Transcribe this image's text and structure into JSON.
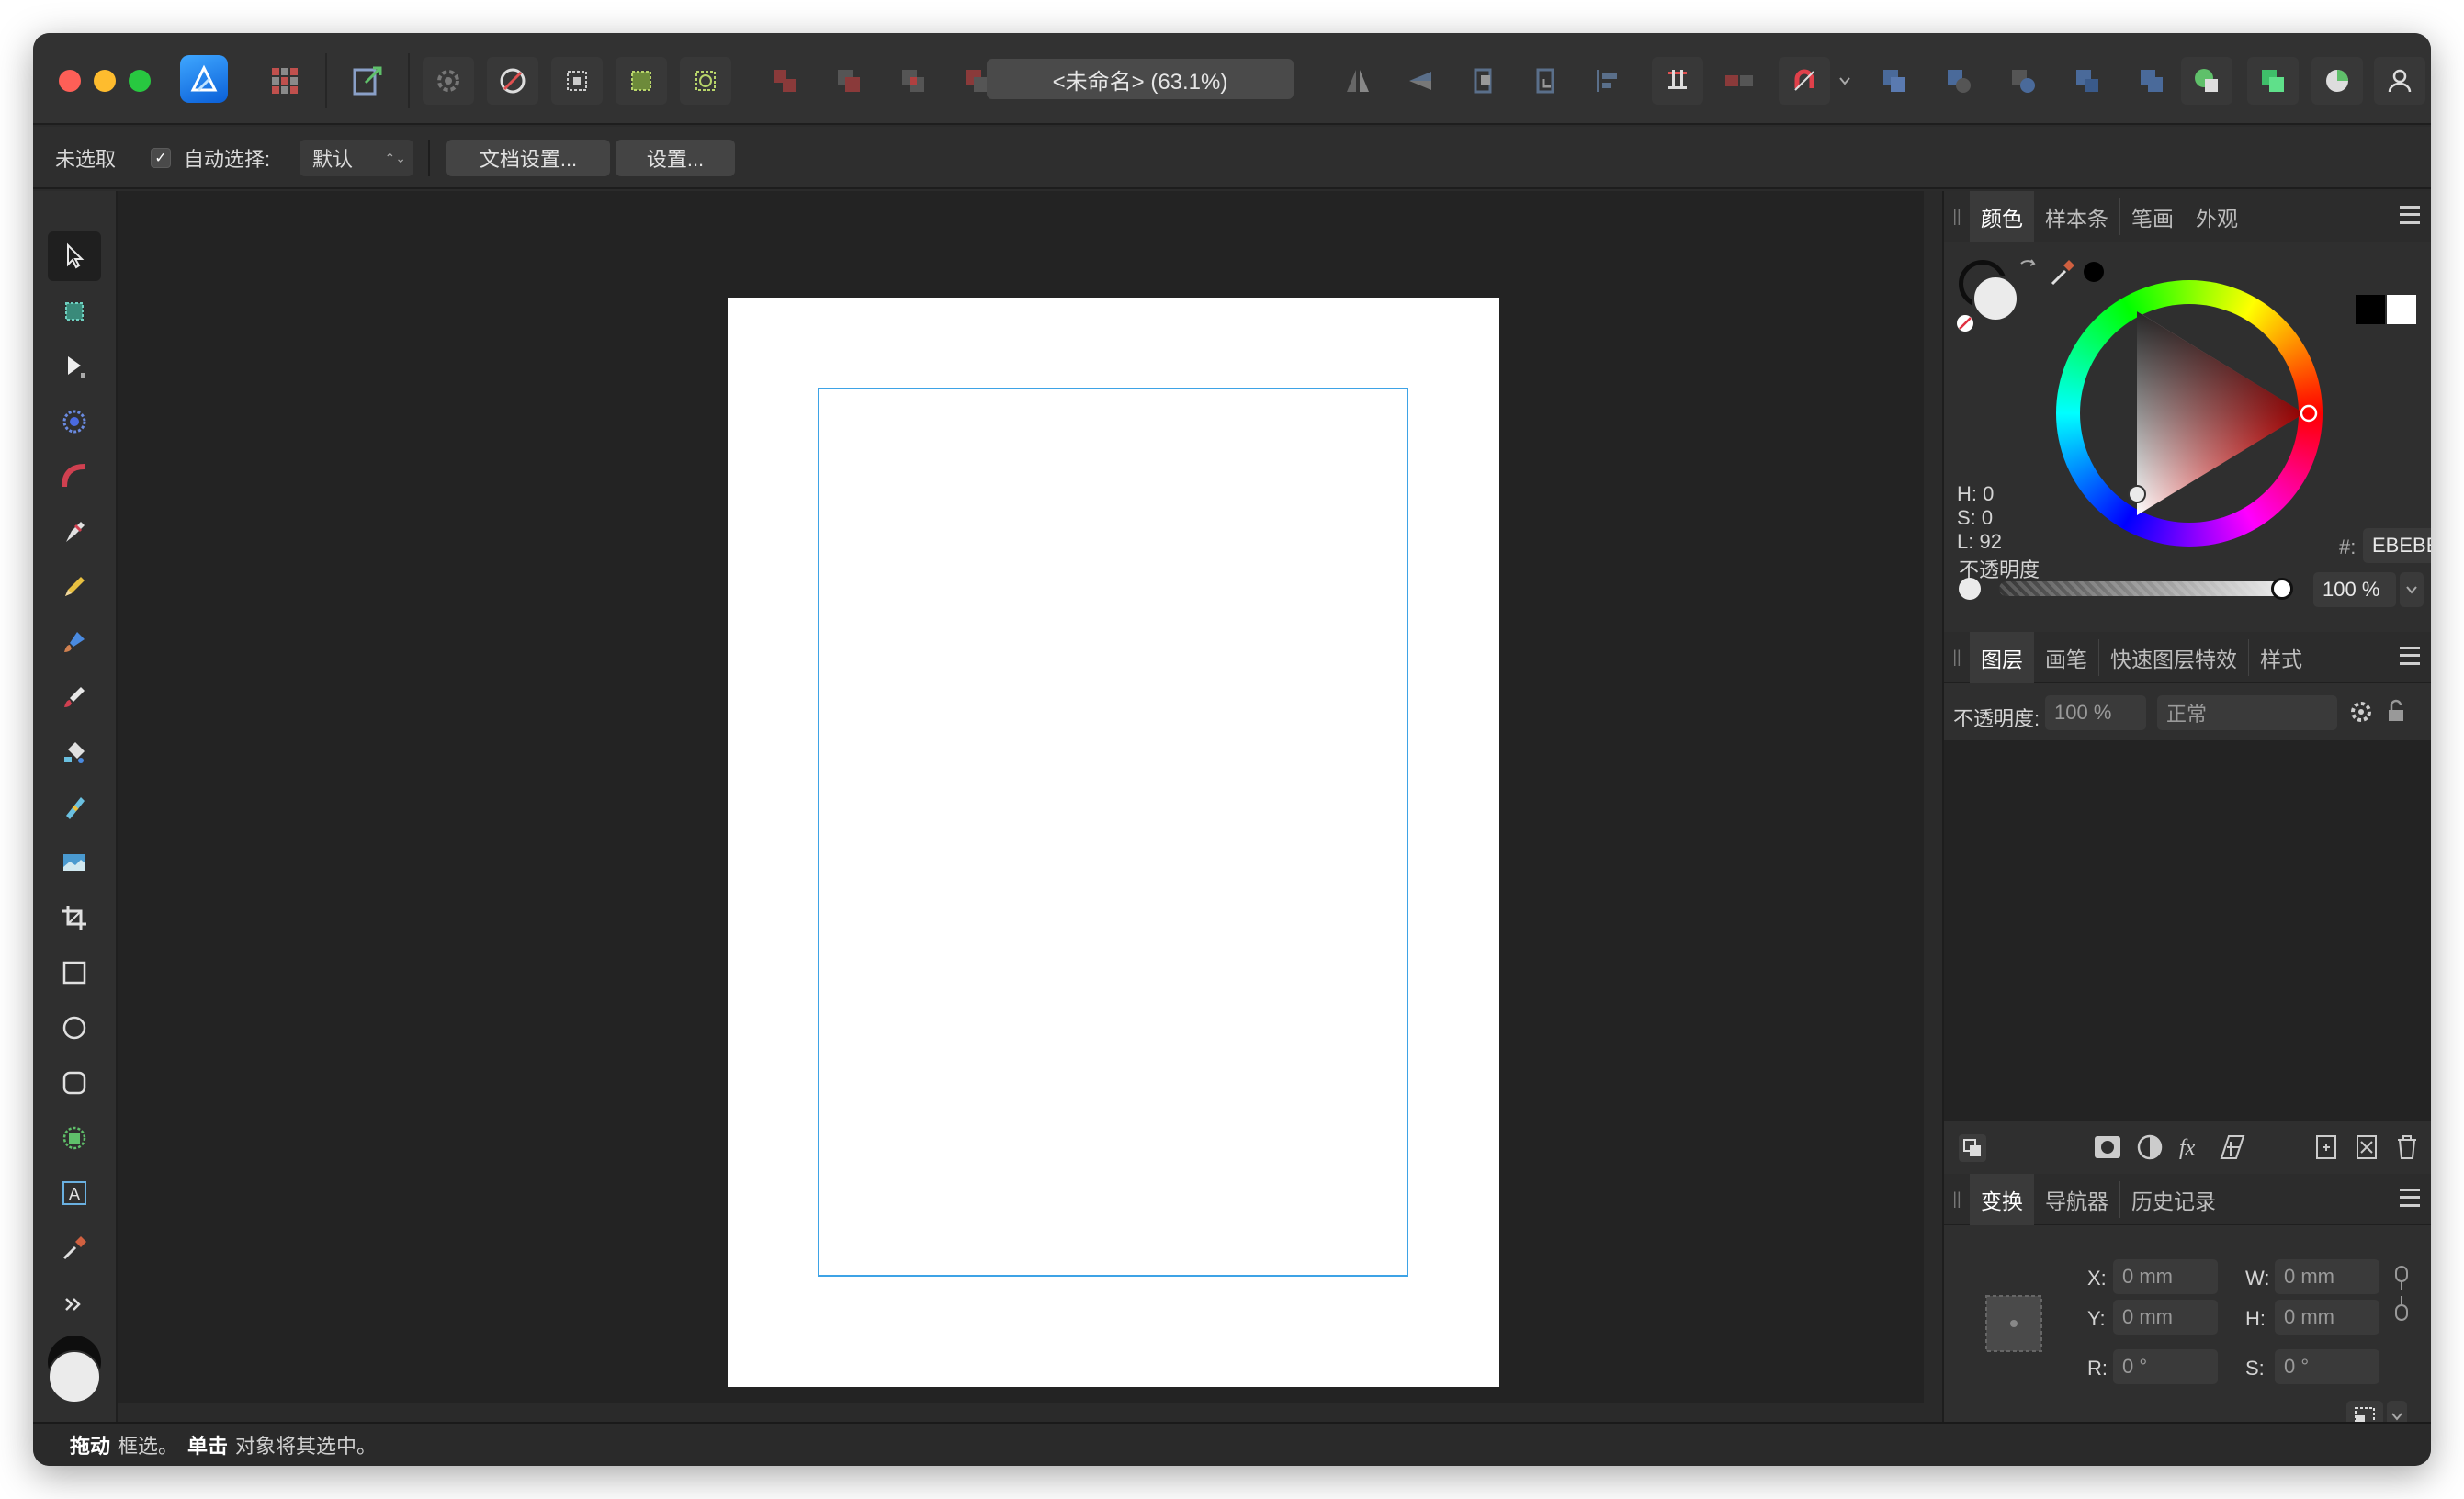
{
  "app": {
    "document_title": "<未命名> (63.1%)",
    "logo_icon": "affinity-designer-logo"
  },
  "context_toolbar": {
    "selection_status": "未选取",
    "auto_select_label": "自动选择:",
    "auto_select_checked": true,
    "auto_select_value": "默认",
    "document_setup_button": "文档设置...",
    "preferences_button": "设置..."
  },
  "color_panel": {
    "tabs": [
      "颜色",
      "样本条",
      "笔画",
      "外观"
    ],
    "h_label": "H: 0",
    "s_label": "S: 0",
    "l_label": "L: 92",
    "hex_prefix": "#:",
    "hex_value": "EBEBEB",
    "opacity_label": "不透明度",
    "opacity_value": "100 %"
  },
  "layers_panel": {
    "tabs": [
      "图层",
      "画笔",
      "快速图层特效",
      "样式"
    ],
    "opacity_label": "不透明度:",
    "opacity_value": "100 %",
    "blend_mode": "正常"
  },
  "transform_panel": {
    "tabs": [
      "变换",
      "导航器",
      "历史记录"
    ],
    "x_label": "X:",
    "x_value": "0 mm",
    "y_label": "Y:",
    "y_value": "0 mm",
    "w_label": "W:",
    "w_value": "0 mm",
    "h_label": "H:",
    "h_value": "0 mm",
    "r_label": "R:",
    "r_value": "0 °",
    "s_label": "S:",
    "s_value": "0 °"
  },
  "status_bar": {
    "drag_bold": "拖动",
    "drag_text": "框选。",
    "click_bold": "单击",
    "click_text": "对象将其选中。"
  },
  "colors": {
    "accent": "#3ea3e6",
    "traffic_red": "#fe5f57",
    "traffic_yellow": "#febc2e",
    "traffic_green": "#28c840"
  }
}
